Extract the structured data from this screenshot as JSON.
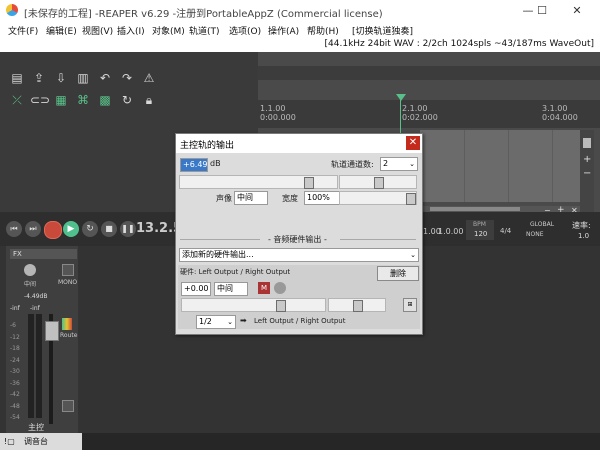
{
  "window": {
    "title": "[未保存的工程] -REAPER v6.29 -注册到PortableAppZ (Commercial license)",
    "min_glyph": "—",
    "max_glyph": "☐",
    "close_glyph": "✕"
  },
  "menu": [
    "文件(F)",
    "编辑(E)",
    "视图(V)",
    "插入(I)",
    "对象(M)",
    "轨道(T)",
    "选项(O)",
    "操作(A)",
    "帮助(H)",
    "[切换轨道独奏]"
  ],
  "infobar": "[44.1kHz 24bit WAV : 2/2ch 1024spls ~43/187ms WaveOut]",
  "ruler": [
    {
      "bar": "1.1.00",
      "time": "0:00.000"
    },
    {
      "bar": "2.1.00",
      "time": "0:02.000"
    },
    {
      "bar": "3.1.00",
      "time": "0:04.000"
    }
  ],
  "transport": {
    "time": "13.2.55",
    "rate_label": "速率:",
    "rate_value": "1.0",
    "bpm_label": "BPM",
    "bpm": "120",
    "timesig": "4/4",
    "global_label": "GLOBAL",
    "none_label": "NONE",
    "val1": "1.00",
    "val2": "1.0.00"
  },
  "mixer": {
    "fx_label": "FX",
    "pan_label": "中间",
    "mono_label": "MONO",
    "peak": "-4.49dB",
    "inf1": "-inf",
    "inf2": "-inf",
    "scale": [
      "-6",
      "-12",
      "-18",
      "-24",
      "-30",
      "-36",
      "-42",
      "-48",
      "-54"
    ],
    "route_label": "Route",
    "master_label": "主控",
    "bottom_tab": "调音台"
  },
  "dialog": {
    "title": "主控轨的输出",
    "volume_value": "+6.49",
    "volume_unit": "dB",
    "channels_label": "轨道通道数:",
    "channels_value": "2",
    "pan_label": "声像",
    "pan_value": "中间",
    "width_label": "宽度",
    "width_value": "100%",
    "hw_section": "- 音频硬件输出 -",
    "add_hw": "添加新的硬件输出...",
    "hw_output_label": "硬件: Left Output / Right Output",
    "delete_button": "删除",
    "hw_volume": "+0.00",
    "hw_pan": "中间",
    "hw_channel": "1/2",
    "hw_dest": "Left Output / Right Output",
    "arrow": "➡"
  },
  "colors": {
    "accent_green": "#59c089",
    "record_red": "#c94a3b",
    "play_green": "#4fc08d",
    "close_red": "#c42b1c"
  }
}
